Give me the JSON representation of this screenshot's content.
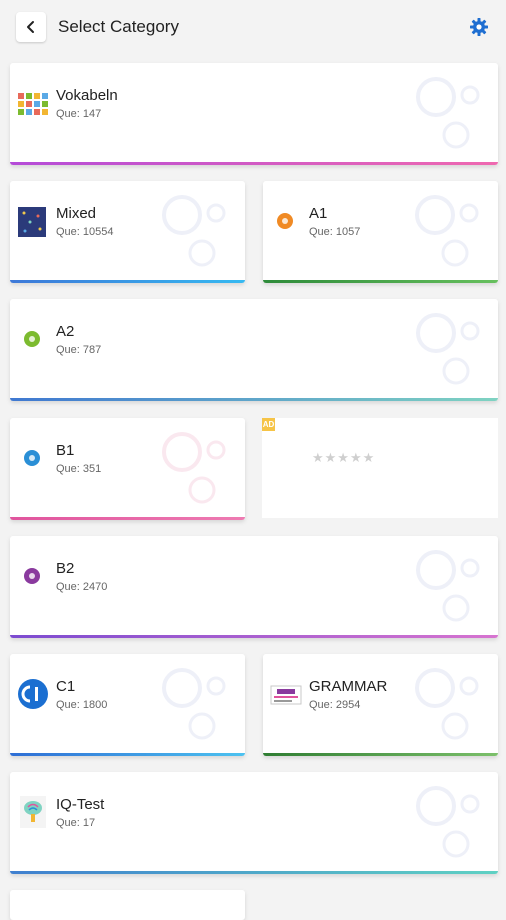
{
  "header": {
    "title": "Select Category"
  },
  "categories": [
    {
      "name": "Vokabeln",
      "que": "Que: 147",
      "bar": "#b44bd8,#ef69b0"
    },
    {
      "name": "Mixed",
      "que": "Que: 10554",
      "bar": "#3d78d8,#36b9f1"
    },
    {
      "name": "A1",
      "que": "Que: 1057",
      "bar": "#2e8b3a,#67c05e"
    },
    {
      "name": "A2",
      "que": "Que: 787",
      "bar": "#3f78d1,#7fd3c2"
    },
    {
      "name": "B1",
      "que": "Que: 351",
      "bar": "#e0549d,#ee7bb2"
    },
    {
      "name": "B2",
      "que": "Que: 2470",
      "bar": "#7c4bd0,#d774d0"
    },
    {
      "name": "C1",
      "que": "Que: 1800",
      "bar": "#2e6ed5,#4cc2f0"
    },
    {
      "name": "GRAMMAR",
      "que": "Que: 2954",
      "bar": "#2f7d32,#7cc06b"
    },
    {
      "name": "IQ-Test",
      "que": "Que: 17",
      "bar": "#3f7fcf,#5fd1c3"
    }
  ],
  "rating": {
    "ad_label": "AD",
    "stars": "★★★★★"
  },
  "colors": {
    "accent": "#1e6ed1",
    "a1": "#f08a24",
    "a2": "#7cbb2f",
    "b1": "#2a8fd6",
    "b2": "#8a3a9e",
    "c1": "#1b6fd1"
  }
}
